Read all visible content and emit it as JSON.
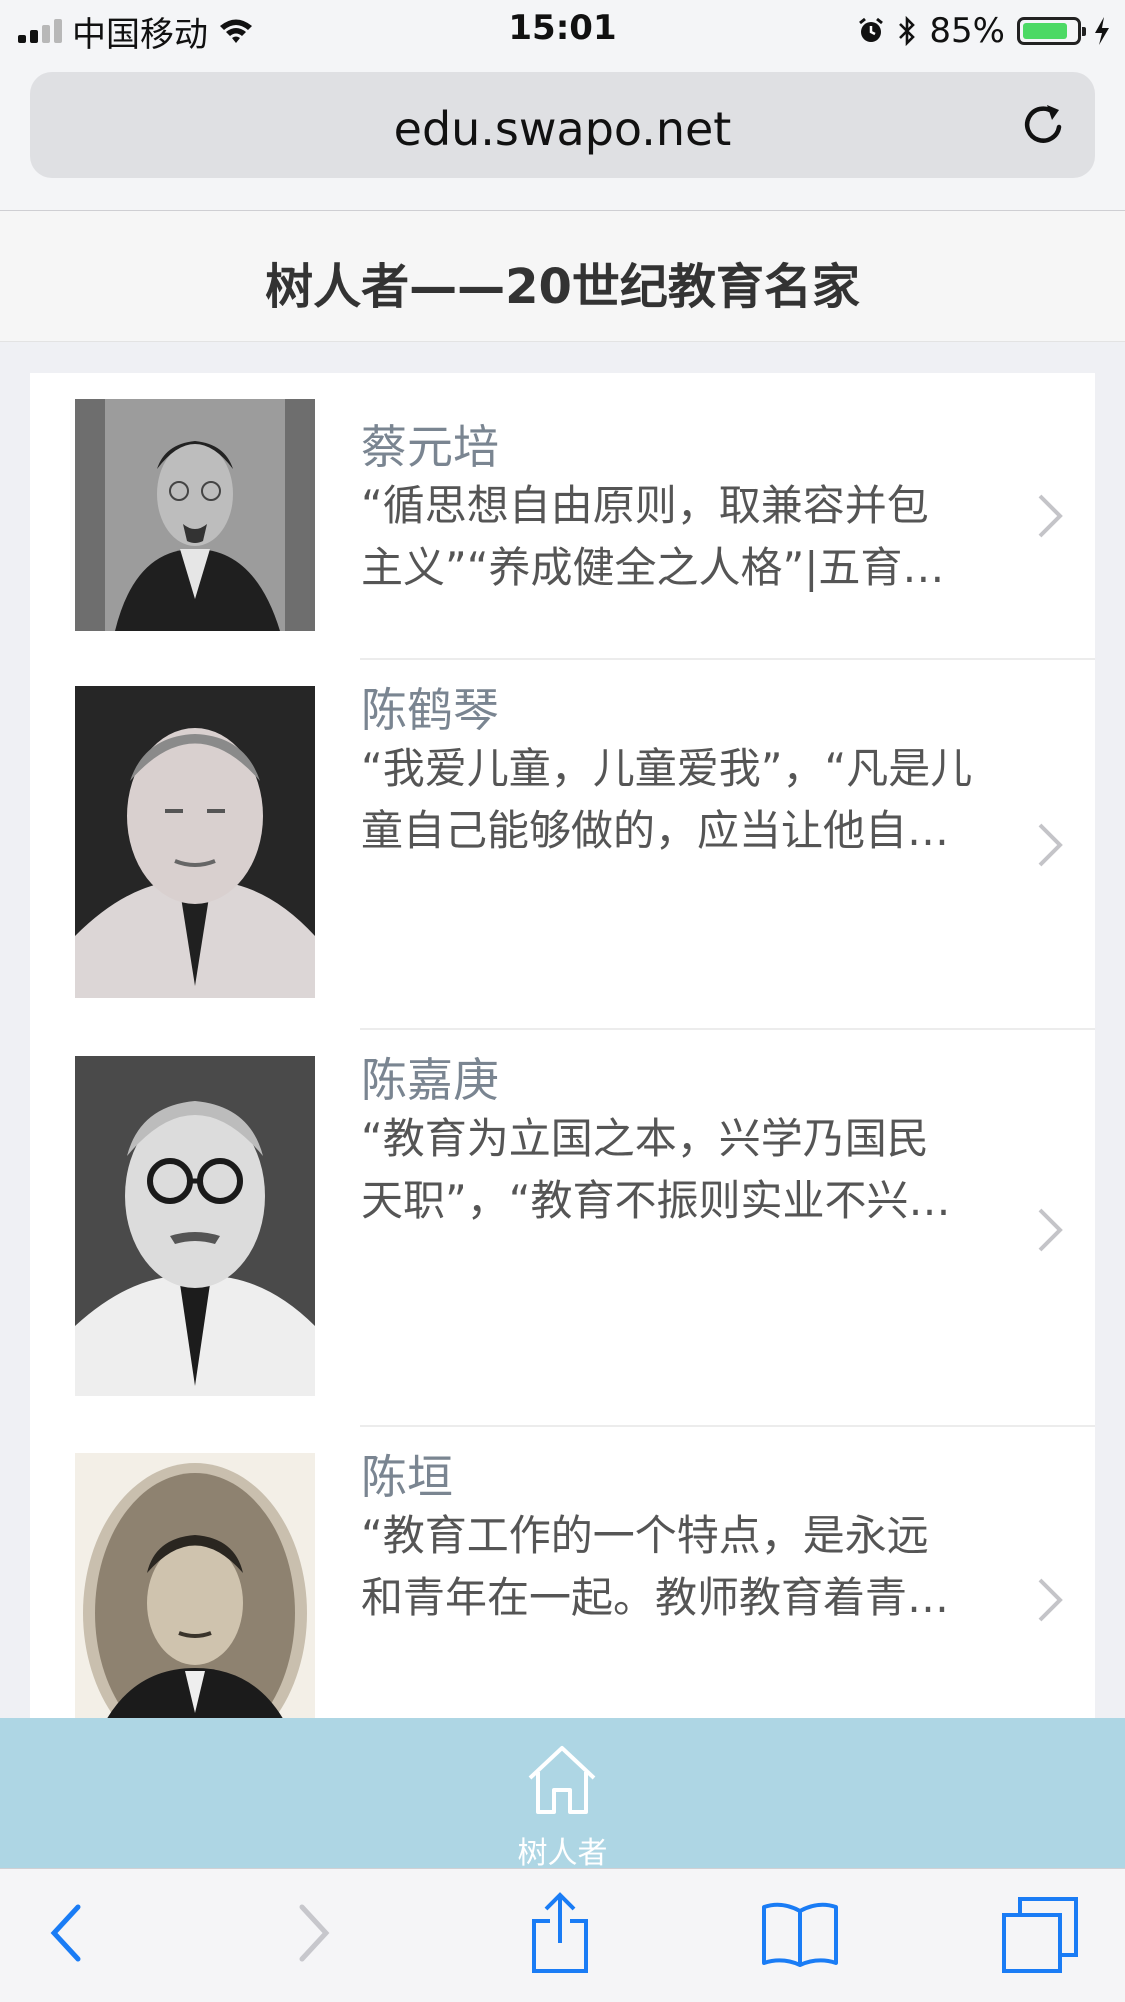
{
  "status_bar": {
    "carrier": "中国移动",
    "time": "15:01",
    "battery": "85%",
    "battery_level": 0.85,
    "icons": [
      "signal-icon",
      "wifi-icon",
      "alarm-icon",
      "bluetooth-icon",
      "battery-icon",
      "charging-icon"
    ]
  },
  "browser": {
    "url": "edu.swapo.net",
    "icons": [
      "reload-icon",
      "back-icon",
      "forward-icon",
      "share-icon",
      "bookmarks-icon",
      "tabs-icon"
    ]
  },
  "page": {
    "title": "树人者——20世纪教育名家"
  },
  "people": [
    {
      "name": "蔡元培",
      "desc_line1": "“循思想自由原则，取兼容并包",
      "desc_line2": "主义”“养成健全之人格”|五育…"
    },
    {
      "name": "陈鹤琴",
      "desc_line1": "“我爱儿童，儿童爱我”，“凡是儿",
      "desc_line2": "童自己能够做的，应当让他自…"
    },
    {
      "name": "陈嘉庚",
      "desc_line1": "“教育为立国之本，兴学乃国民",
      "desc_line2": "天职”，“教育不振则实业不兴…"
    },
    {
      "name": "陈垣",
      "desc_line1": "“教育工作的一个特点，是永远",
      "desc_line2": "和青年在一起。教师教育着青…"
    }
  ],
  "tab_bar": {
    "home_label": "树人者",
    "icon": "home-icon"
  }
}
